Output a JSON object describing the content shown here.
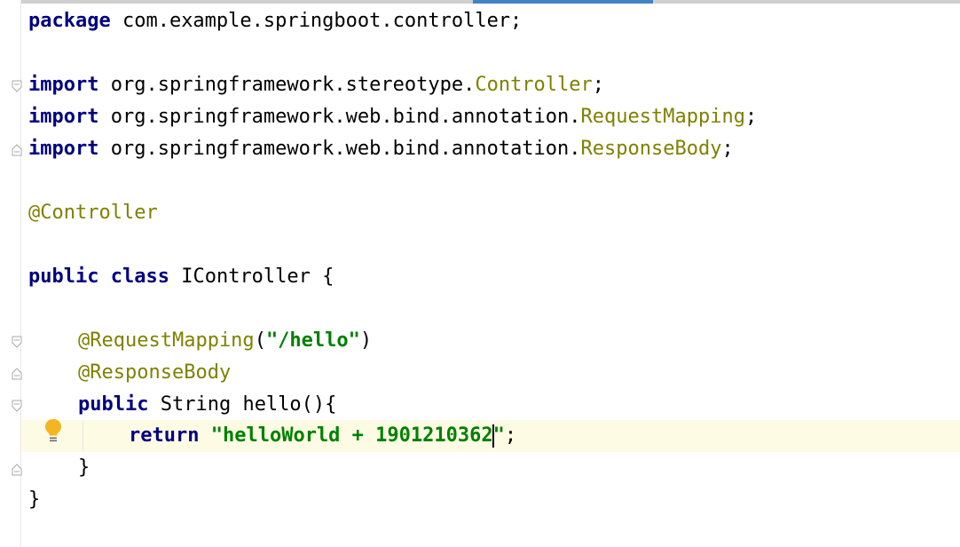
{
  "editor": {
    "lines": [
      {
        "id": "package",
        "parts": [
          "package",
          " com.example.springboot.controller;"
        ]
      },
      {
        "id": "import1",
        "parts": [
          "import",
          " org.springframework.stereotype.",
          "Controller",
          ";"
        ]
      },
      {
        "id": "import2",
        "parts": [
          "import",
          " org.springframework.web.bind.annotation.",
          "RequestMapping",
          ";"
        ]
      },
      {
        "id": "import3",
        "parts": [
          "import",
          " org.springframework.web.bind.annotation.",
          "ResponseBody",
          ";"
        ]
      },
      {
        "id": "annotation-controller",
        "parts": [
          "@Controller"
        ]
      },
      {
        "id": "class-decl",
        "parts": [
          "public",
          " ",
          "class",
          " IController {"
        ]
      },
      {
        "id": "annotation-requestmapping",
        "parts": [
          "@RequestMapping",
          "(",
          "\"/hello\"",
          ")"
        ]
      },
      {
        "id": "annotation-responsebody",
        "parts": [
          "@ResponseBody"
        ]
      },
      {
        "id": "method-decl",
        "parts": [
          "public",
          " String hello(){"
        ]
      },
      {
        "id": "return-stmt",
        "parts": [
          "return",
          " ",
          "\"helloWorld + 1901210362",
          "\"",
          ";"
        ]
      },
      {
        "id": "method-close",
        "parts": [
          "}"
        ]
      },
      {
        "id": "class-close",
        "parts": [
          "}"
        ]
      }
    ]
  },
  "colors": {
    "keyword": "#000080",
    "annotation": "#808000",
    "string": "#008000",
    "current_line": "#fdfbe4",
    "tab_indicator": "#4083c9"
  },
  "icons": {
    "intention": "lightbulb-icon",
    "fold": "fold-marker-icon"
  }
}
